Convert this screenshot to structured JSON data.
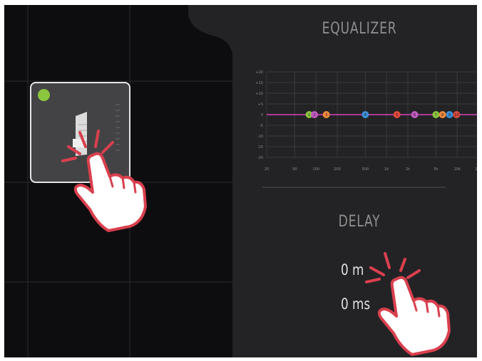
{
  "equalizer": {
    "title": "EQUALIZER"
  },
  "eq_chart": {
    "y_ticks": [
      "+20",
      "+15",
      "+10",
      "+5",
      "0",
      "-5",
      "-10",
      "-15",
      "-20"
    ],
    "x_ticks": [
      "20",
      "50",
      "100",
      "200",
      "500",
      "1k",
      "2k",
      "5k",
      "10k",
      "20k"
    ],
    "bands": [
      {
        "label": "1",
        "color": "#8bc63e",
        "freq": 80
      },
      {
        "label": "2",
        "color": "#c25bc1",
        "freq": 95
      },
      {
        "label": "3",
        "color": "#f08a3c",
        "freq": 140
      },
      {
        "label": "4",
        "color": "#3d8fd6",
        "freq": 500
      },
      {
        "label": "5",
        "color": "#e0493c",
        "freq": 1400
      },
      {
        "label": "6",
        "color": "#c25bc1",
        "freq": 2500
      },
      {
        "label": "7",
        "color": "#8bc63e",
        "freq": 5000
      },
      {
        "label": "8",
        "color": "#f08a3c",
        "freq": 6200
      },
      {
        "label": "9",
        "color": "#3d8fd6",
        "freq": 7800
      },
      {
        "label": "10",
        "color": "#e0493c",
        "freq": 9800
      }
    ],
    "line_color": "#d93fc0"
  },
  "delay": {
    "title": "DELAY",
    "distance": "0 m",
    "time": "0 ms"
  },
  "colors": {
    "status_dot": "#8bc63e",
    "hand_outline": "#d9404e"
  }
}
